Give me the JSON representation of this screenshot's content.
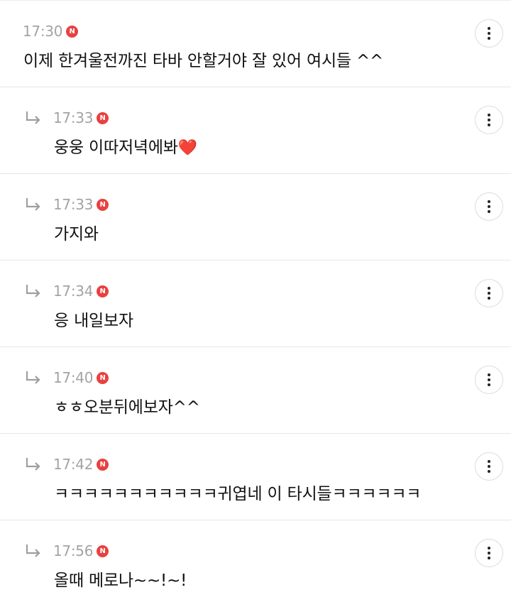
{
  "comments": [
    {
      "time": "17:30",
      "badge": "N",
      "text": "이제 한겨울전까진 타바 안할거야 잘 있어 여시들 ^^",
      "is_reply": false
    },
    {
      "time": "17:33",
      "badge": "N",
      "text": "웅웅 이따저녁에봐",
      "emoji": "❤️",
      "is_reply": true
    },
    {
      "time": "17:33",
      "badge": "N",
      "text": "가지와",
      "is_reply": true
    },
    {
      "time": "17:34",
      "badge": "N",
      "text": "응 내일보자",
      "is_reply": true
    },
    {
      "time": "17:40",
      "badge": "N",
      "text": "ㅎㅎ오분뒤에보자^^",
      "is_reply": true
    },
    {
      "time": "17:42",
      "badge": "N",
      "text": "ㅋㅋㅋㅋㅋㅋㅋㅋㅋㅋㅋ귀엽네 이 타시들ㅋㅋㅋㅋㅋㅋ",
      "is_reply": true
    },
    {
      "time": "17:56",
      "badge": "N",
      "text": "올때 메로나~~!~!",
      "is_reply": true
    }
  ],
  "colors": {
    "badge": "#e8413f",
    "time": "#a3a3a3",
    "text": "#111111",
    "divider": "#e6e6e6",
    "heart": "#e53935"
  },
  "icons": {
    "reply": "reply-arrow-icon",
    "new": "new-badge-icon",
    "more": "more-vertical-icon"
  }
}
